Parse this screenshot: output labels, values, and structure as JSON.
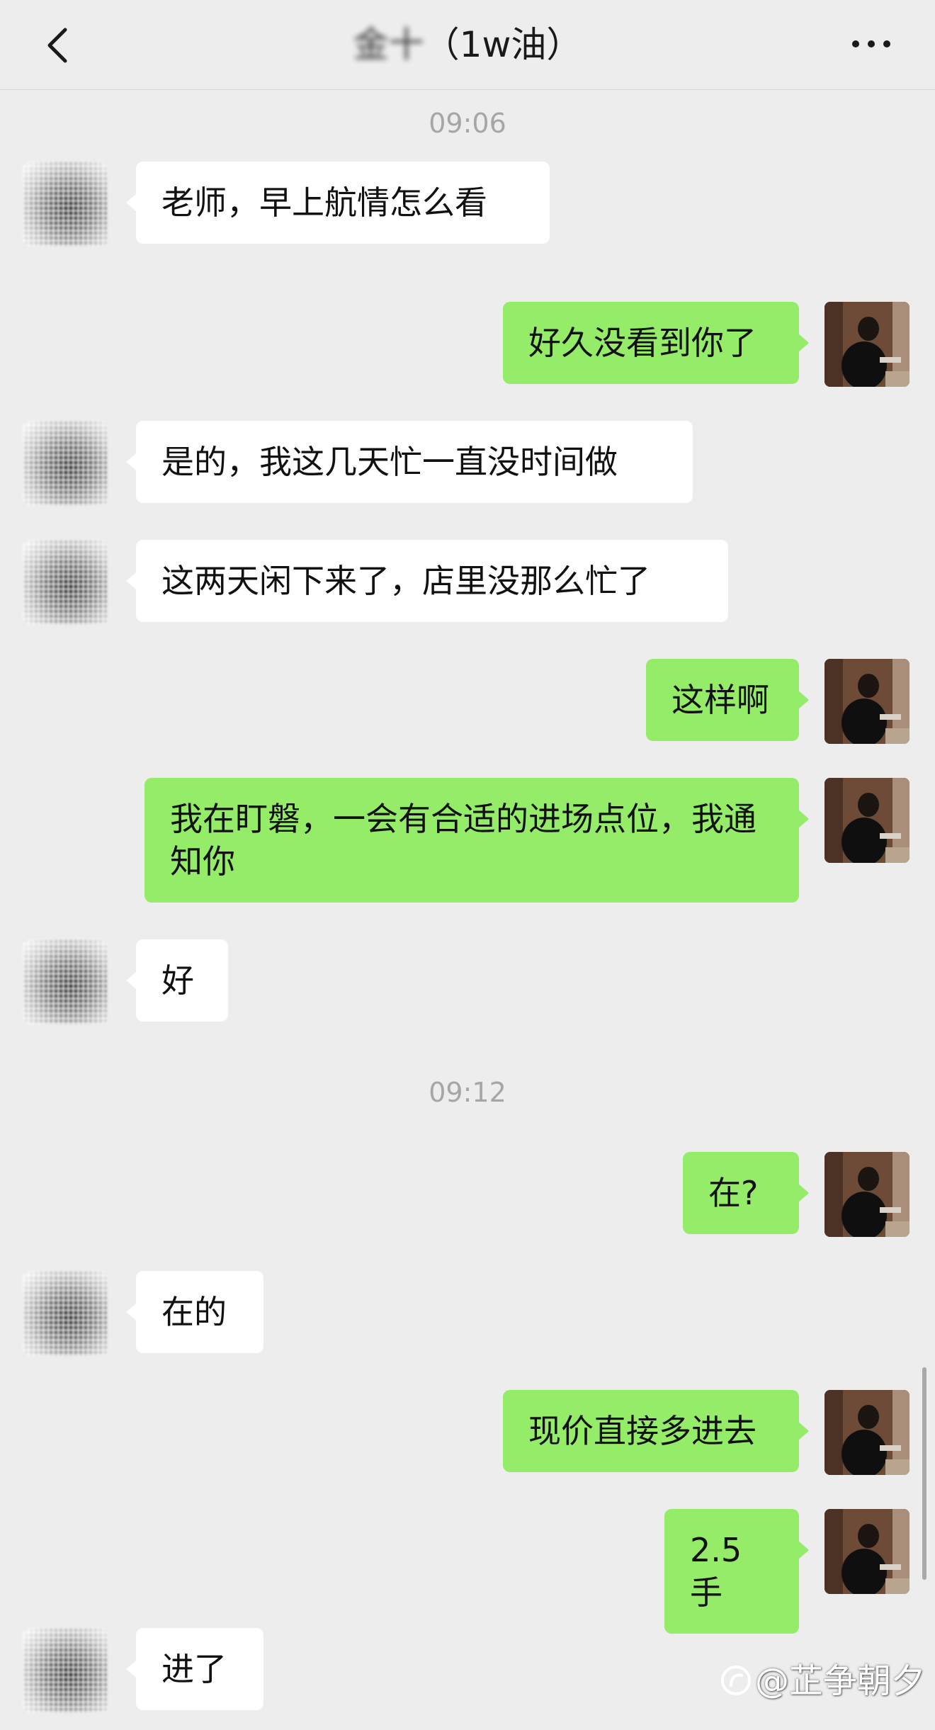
{
  "header": {
    "title_blurred": "金十",
    "title_suffix": "（1w油）",
    "back_icon": "chevron-left-icon",
    "more_icon": "more-dots-icon"
  },
  "timestamps": [
    "09:06",
    "09:12"
  ],
  "messages": [
    {
      "side": "left",
      "text": "老师，早上航情怎么看"
    },
    {
      "side": "right",
      "text": "好久没看到你了"
    },
    {
      "side": "left",
      "text": "是的，我这几天忙一直没时间做"
    },
    {
      "side": "left",
      "text": "这两天闲下来了，店里没那么忙了"
    },
    {
      "side": "right",
      "text": "这样啊"
    },
    {
      "side": "right",
      "text": "我在盯磐，一会有合适的进场点位，我通知你"
    },
    {
      "side": "left",
      "text": "好"
    },
    {
      "side": "right",
      "text": "在?"
    },
    {
      "side": "left",
      "text": "在的"
    },
    {
      "side": "right",
      "text": "现价直接多进去"
    },
    {
      "side": "right",
      "text": "2.5手"
    },
    {
      "side": "left",
      "text": "进了"
    }
  ],
  "watermark": {
    "text": "@芷争朝夕",
    "icon": "logo-icon"
  },
  "colors": {
    "background": "#ededed",
    "bubble_self": "#95ec69",
    "bubble_other": "#ffffff",
    "timestamp": "#a6a6a6"
  }
}
